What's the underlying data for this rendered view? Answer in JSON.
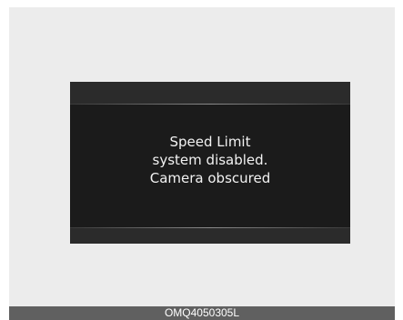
{
  "display": {
    "message_lines": [
      "Speed Limit",
      "system disabled.",
      "Camera obscured"
    ]
  },
  "footer": {
    "code": "OMQ4050305L"
  }
}
